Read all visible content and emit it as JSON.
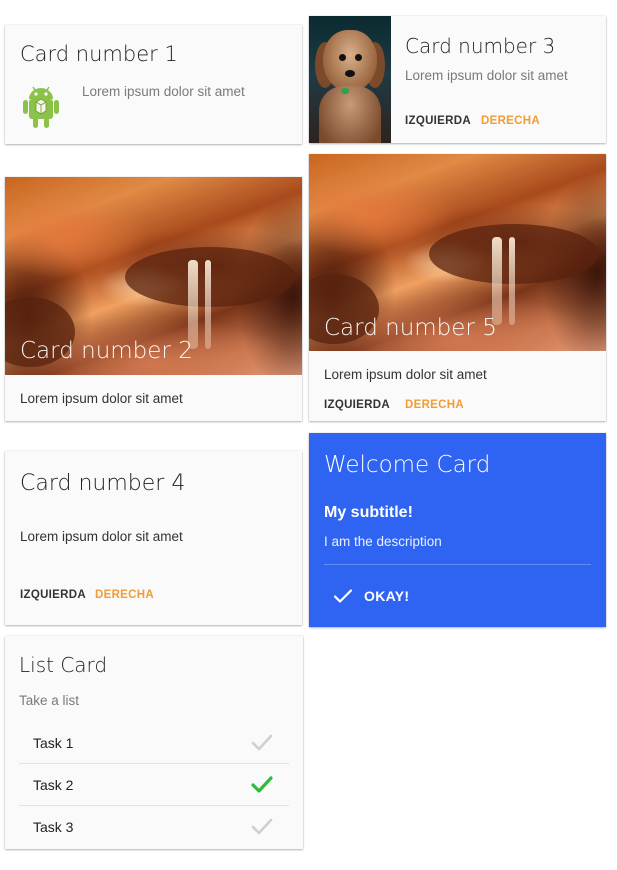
{
  "cards": {
    "card1": {
      "title": "Card number 1",
      "text": "Lorem ipsum dolor sit amet",
      "icon": "android-icon"
    },
    "card3": {
      "title": "Card number 3",
      "text": "Lorem ipsum dolor sit amet",
      "left_btn": "IZQUIERDA",
      "right_btn": "DERECHA",
      "image": "dog-photo"
    },
    "card2": {
      "title": "Card number 2",
      "text": "Lorem ipsum dolor sit amet",
      "image": "canyon-photo"
    },
    "card5": {
      "title": "Card number 5",
      "text": "Lorem ipsum dolor sit amet",
      "left_btn": "IZQUIERDA",
      "right_btn": "DERECHA",
      "image": "canyon-photo"
    },
    "card4": {
      "title": "Card number 4",
      "text": "Lorem ipsum dolor sit amet",
      "left_btn": "IZQUIERDA",
      "right_btn": "DERECHA"
    },
    "welcome": {
      "title": "Welcome Card",
      "subtitle": "My subtitle!",
      "description": "I am the description",
      "button": "OKAY!",
      "icon": "check-icon",
      "color": "#2f64f2"
    },
    "list": {
      "title": "List Card",
      "subtitle": "Take a list",
      "items": [
        {
          "label": "Task 1",
          "checked": false
        },
        {
          "label": "Task 2",
          "checked": true
        },
        {
          "label": "Task 3",
          "checked": false
        }
      ]
    }
  },
  "colors": {
    "accent_orange": "#f39c35",
    "check_green": "#2dbb3c",
    "check_gray": "#c9c9c9",
    "card_bg": "#fafafa"
  }
}
